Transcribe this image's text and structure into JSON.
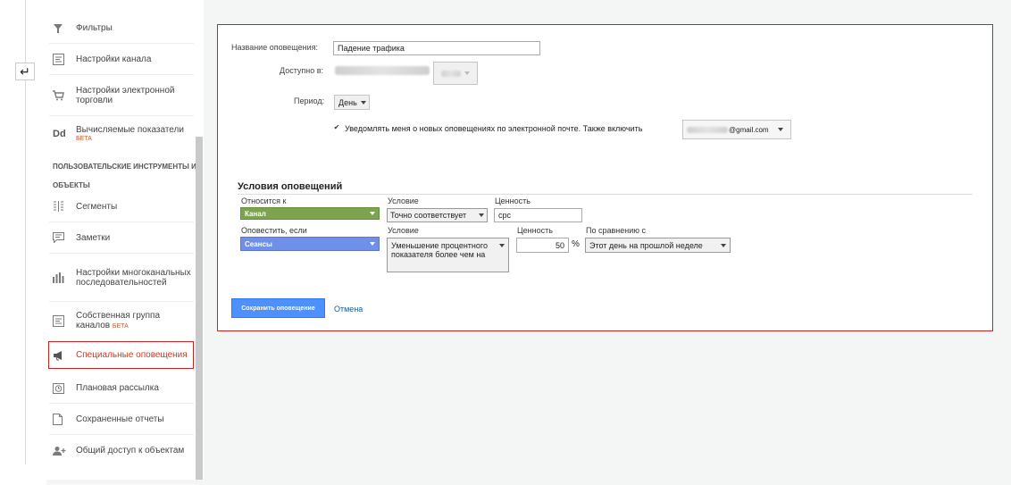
{
  "sidebar": {
    "items": [
      {
        "label": "Фильтры",
        "icon": "filter-icon"
      },
      {
        "label": "Настройки канала",
        "icon": "channel-settings-icon"
      },
      {
        "label": "Настройки электронной торговли",
        "icon": "cart-icon"
      },
      {
        "label": "Вычисляемые показатели",
        "beta": "БЕТА",
        "icon": "dd-icon"
      },
      {
        "label": "Сегменты",
        "icon": "segments-icon"
      },
      {
        "label": "Заметки",
        "icon": "notes-icon"
      },
      {
        "label": "Настройки многоканальных последовательностей",
        "icon": "bars-icon"
      },
      {
        "label": "Собственная группа каналов",
        "beta": "БЕТА",
        "icon": "channel-group-icon"
      },
      {
        "label": "Специальные оповещения",
        "icon": "megaphone-icon"
      },
      {
        "label": "Плановая рассылка",
        "icon": "clock-icon"
      },
      {
        "label": "Сохраненные отчеты",
        "icon": "document-icon"
      },
      {
        "label": "Общий доступ к объектам",
        "icon": "share-user-icon"
      }
    ],
    "section_line1": "ПОЛЬЗОВАТЕЛЬСКИЕ ИНСТРУМЕНТЫ И",
    "section_line2": "ОБЪЕКТЫ",
    "dd_glyph": "Dd"
  },
  "form": {
    "name_label": "Название оповещения:",
    "name_value": "Падение трафика",
    "available_label": "Доступно в:",
    "period_label": "Период:",
    "period_value": "День",
    "notify_text": "Уведомлять меня о новых оповещениях по электронной почте. Также включить",
    "email_suffix": "@gmail.com",
    "notify_checked": true
  },
  "conditions": {
    "title": "Условия оповещений",
    "row1": {
      "applies_label": "Относится к",
      "applies_value": "Канал",
      "condition_label": "Условие",
      "condition_value": "Точно соответствует",
      "value_label": "Ценность",
      "value_value": "cpc"
    },
    "row2": {
      "alert_label": "Оповестить, если",
      "alert_value": "Сеансы",
      "condition_label": "Условие",
      "condition_value": "Уменьшение процентного показателя более чем на",
      "value_label": "Ценность",
      "value_value": "50",
      "percent": "%",
      "compare_label": "По сравнению с",
      "compare_value": "Этот день на прошлой неделе"
    }
  },
  "actions": {
    "save": "Сохранить оповещение",
    "cancel": "Отмена"
  },
  "colors": {
    "accent_red": "#cc1f1f",
    "green_select": "#7ea34e",
    "blue_select": "#6f8fe8",
    "save_button": "#4d90fe"
  }
}
